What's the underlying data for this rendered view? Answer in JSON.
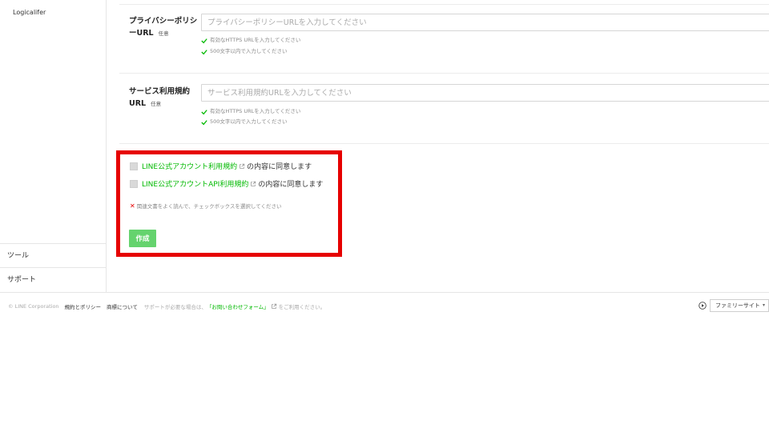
{
  "sidebar": {
    "account_name": "Logicalifer",
    "items": [
      {
        "label": "ツール"
      },
      {
        "label": "サポート"
      }
    ]
  },
  "privacy": {
    "label_line1": "プライバシーポリシ",
    "label_line2": "ーURL",
    "optional": "任意",
    "placeholder": "プライバシーポリシーURLを入力してください",
    "hints": [
      "有効なHTTPS URLを入力してください",
      "500文字以内で入力してください"
    ]
  },
  "terms": {
    "label_line1": "サービス利用規約",
    "label_line2": "URL",
    "optional": "任意",
    "placeholder": "サービス利用規約URLを入力してください",
    "hints": [
      "有効なHTTPS URLを入力してください",
      "500文字以内で入力してください"
    ]
  },
  "agreements": {
    "items": [
      {
        "link": "LINE公式アカウント利用規約",
        "suffix": "の内容に同意します"
      },
      {
        "link": "LINE公式アカウントAPI利用規約",
        "suffix": "の内容に同意します"
      }
    ],
    "error": "関連文書をよく読んで、チェックボックスを選択してください",
    "create_label": "作成"
  },
  "footer": {
    "copyright": "© LINE Corporation",
    "links": [
      "規約とポリシー",
      "商標について"
    ],
    "support_prefix": "サポートが必要な場合は、",
    "support_link": "「お問い合わせフォーム」",
    "support_suffix": "をご利用ください。",
    "family_site": "ファミリーサイト"
  },
  "colors": {
    "accent": "#00b900",
    "button": "#65d36e",
    "highlight": "#e60000"
  }
}
